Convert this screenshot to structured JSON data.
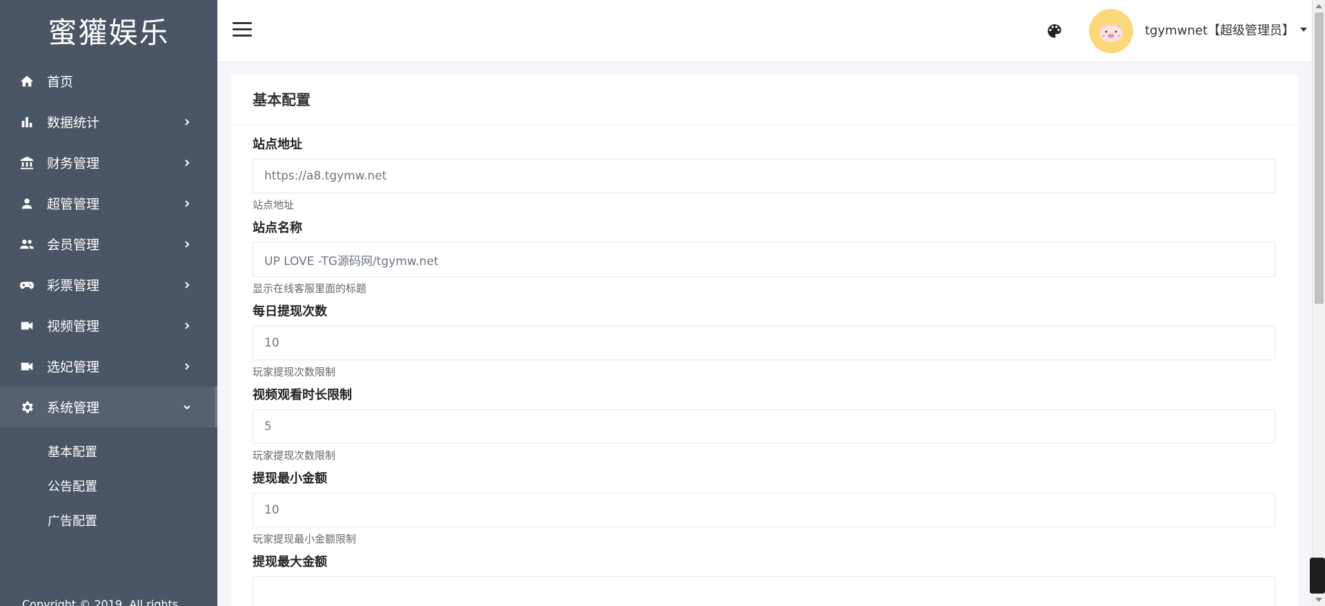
{
  "brand": "蜜獾娱乐",
  "sidebar": {
    "items": [
      {
        "label": "首页",
        "icon": "home-icon",
        "has_children": false
      },
      {
        "label": "数据统计",
        "icon": "bar-chart-icon",
        "has_children": true
      },
      {
        "label": "财务管理",
        "icon": "bank-icon",
        "has_children": true
      },
      {
        "label": "超管管理",
        "icon": "person-icon",
        "has_children": true
      },
      {
        "label": "会员管理",
        "icon": "people-icon",
        "has_children": true
      },
      {
        "label": "彩票管理",
        "icon": "gamepad-icon",
        "has_children": true
      },
      {
        "label": "视频管理",
        "icon": "videocam-icon",
        "has_children": true
      },
      {
        "label": "选妃管理",
        "icon": "videocam-icon",
        "has_children": true
      },
      {
        "label": "系统管理",
        "icon": "gear-icon",
        "has_children": true,
        "expanded": true
      }
    ],
    "subitems": [
      "基本配置",
      "公告配置",
      "广告配置"
    ],
    "copyright": "Copyright © 2019. All rights"
  },
  "header": {
    "user": "tgymwnet【超级管理员】",
    "icons": [
      "menu-icon",
      "palette-icon",
      "pig-avatar"
    ]
  },
  "card": {
    "title": "基本配置",
    "fields": [
      {
        "label": "站点地址",
        "value": "https://a8.tgymw.net",
        "help": "站点地址"
      },
      {
        "label": "站点名称",
        "value": "UP LOVE -TG源码网/tgymw.net",
        "help": "显示在线客服里面的标题"
      },
      {
        "label": "每日提现次数",
        "value": "10",
        "help": "玩家提现次数限制"
      },
      {
        "label": "视频观看时长限制",
        "value": "5",
        "help": "玩家提现次数限制"
      },
      {
        "label": "提现最小金额",
        "value": "10",
        "help": "玩家提现最小金额限制"
      },
      {
        "label": "提现最大金额",
        "value": "",
        "help": ""
      }
    ]
  }
}
